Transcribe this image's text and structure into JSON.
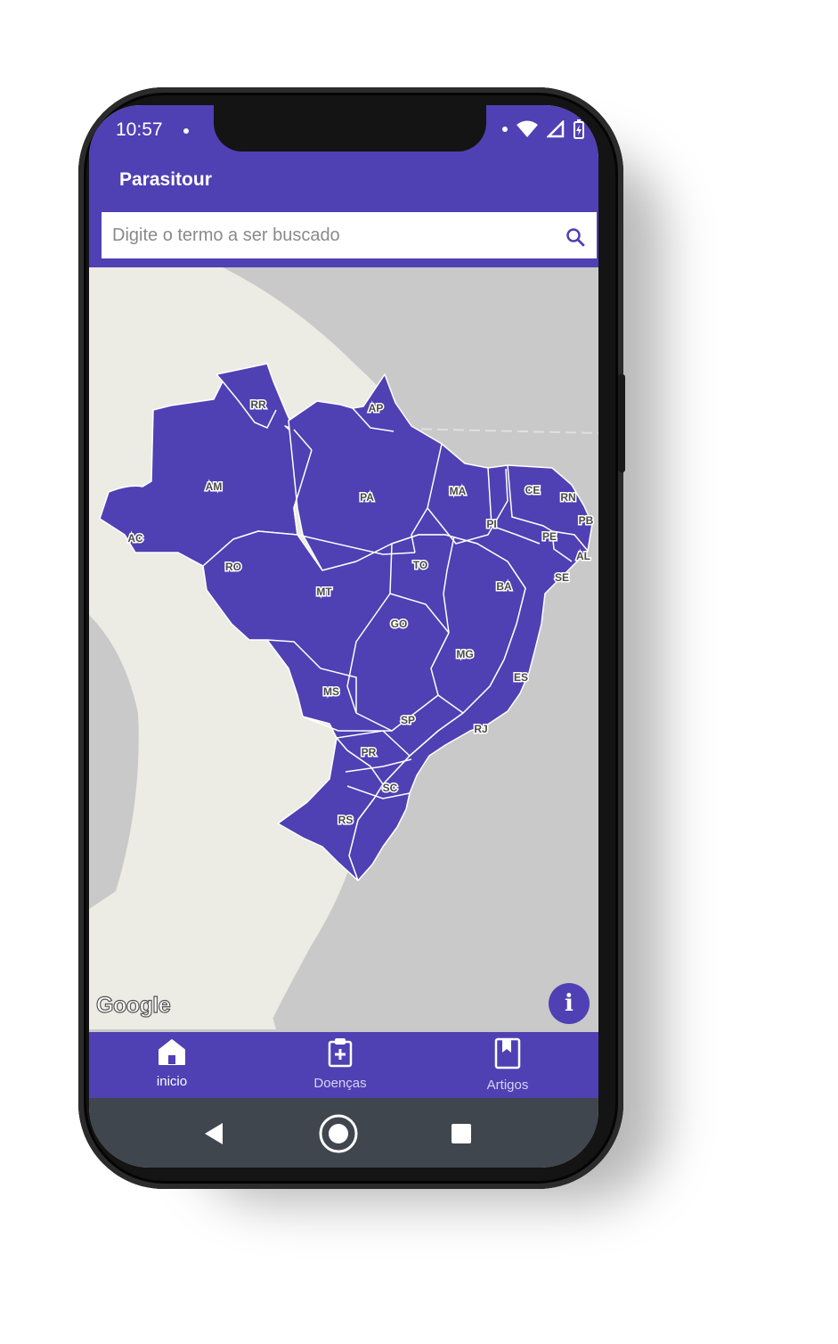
{
  "status_bar": {
    "time": "10:57"
  },
  "app": {
    "title": "Parasitour"
  },
  "search": {
    "placeholder": "Digite o termo a ser buscado"
  },
  "map": {
    "attribution": "Google",
    "info_button": "i",
    "states": [
      "RR",
      "AP",
      "AM",
      "PA",
      "MA",
      "CE",
      "RN",
      "PB",
      "PE",
      "AL",
      "SE",
      "PI",
      "AC",
      "RO",
      "TO",
      "BA",
      "MT",
      "GO",
      "MG",
      "ES",
      "MS",
      "SP",
      "RJ",
      "PR",
      "SC",
      "RS"
    ],
    "colors": {
      "state_fill": "#4f40b4",
      "land": "#ecebe4",
      "water": "#c9c9c9"
    }
  },
  "bottom_nav": {
    "items": [
      {
        "label": "inicio",
        "icon": "home-icon",
        "active": true
      },
      {
        "label": "Doenças",
        "icon": "medical-clipboard-icon",
        "active": false
      },
      {
        "label": "Artigos",
        "icon": "bookmark-icon",
        "active": false
      }
    ]
  },
  "colors": {
    "primary": "#4f40b4",
    "system_nav": "#40464d"
  }
}
